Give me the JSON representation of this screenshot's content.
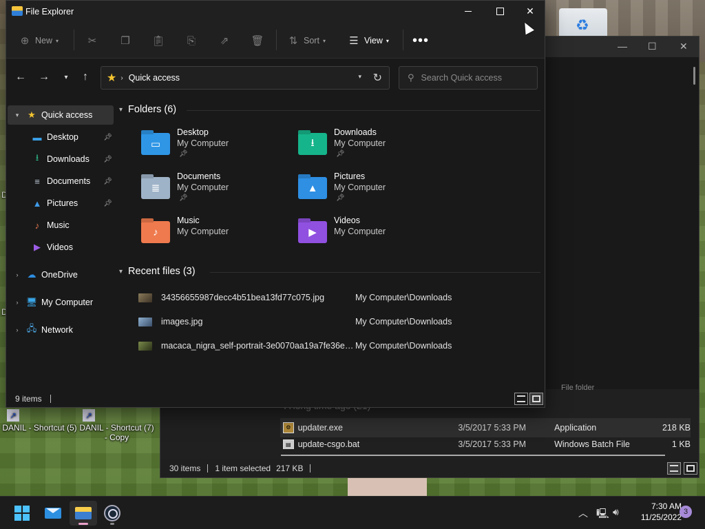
{
  "desktop": {
    "shortcut1": "DANIL - Shortcut (5)",
    "shortcut2": "DANIL - Shortcut (7) - Copy"
  },
  "background_window": {
    "group_label": "A long time ago (21)",
    "file_folder_text": "File folder",
    "rows": [
      {
        "name": "updater.exe",
        "date": "3/5/2017 5:33 PM",
        "type": "Application",
        "size": "218 KB"
      },
      {
        "name": "update-csgo.bat",
        "date": "3/5/2017 5:33 PM",
        "type": "Windows Batch File",
        "size": "1 KB"
      }
    ],
    "status": {
      "items": "30 items",
      "selected": "1 item selected",
      "size": "217 KB"
    }
  },
  "window": {
    "title": "File Explorer",
    "toolbar": {
      "new_label": "New",
      "sort_label": "Sort",
      "view_label": "View"
    },
    "address": {
      "crumb": "Quick access"
    },
    "search": {
      "placeholder": "Search Quick access"
    },
    "nav": {
      "quick_access": "Quick access",
      "pinned": [
        {
          "label": "Desktop",
          "icon": "desktop-icon",
          "color": "#3aa0e8",
          "glyph": "▬",
          "pinned": true
        },
        {
          "label": "Downloads",
          "icon": "downloads-icon",
          "color": "#2fbf8f",
          "glyph": "⭳",
          "pinned": true
        },
        {
          "label": "Documents",
          "icon": "documents-icon",
          "color": "#b8c4d0",
          "glyph": "≡",
          "pinned": true
        },
        {
          "label": "Pictures",
          "icon": "pictures-icon",
          "color": "#3f9be8",
          "glyph": "▲",
          "pinned": true
        },
        {
          "label": "Music",
          "icon": "music-icon",
          "color": "#ee7b52",
          "glyph": "♪",
          "pinned": false
        },
        {
          "label": "Videos",
          "icon": "videos-icon",
          "color": "#9b5de5",
          "glyph": "▶",
          "pinned": false
        }
      ],
      "onedrive": "OneDrive",
      "my_computer": "My Computer",
      "network": "Network"
    },
    "folders_header": "Folders (6)",
    "folders": [
      {
        "name": "Desktop",
        "location": "My Computer",
        "pinned": true,
        "color": "#2f96e6",
        "icon": "desktop-folder-icon",
        "glyph": "▭"
      },
      {
        "name": "Downloads",
        "location": "My Computer",
        "pinned": true,
        "color": "#16b48a",
        "icon": "downloads-folder-icon",
        "glyph": "⭳"
      },
      {
        "name": "Documents",
        "location": "My Computer",
        "pinned": true,
        "color": "#9fb3c8",
        "icon": "documents-folder-icon",
        "glyph": "≣"
      },
      {
        "name": "Pictures",
        "location": "My Computer",
        "pinned": true,
        "color": "#2e8fe3",
        "icon": "pictures-folder-icon",
        "glyph": "▲"
      },
      {
        "name": "Music",
        "location": "My Computer",
        "pinned": false,
        "color": "#ef7a4d",
        "icon": "music-folder-icon",
        "glyph": "♪"
      },
      {
        "name": "Videos",
        "location": "My Computer",
        "pinned": false,
        "color": "#9050e0",
        "icon": "videos-folder-icon",
        "glyph": "▶"
      }
    ],
    "recent_header": "Recent files (3)",
    "recent": [
      {
        "name": "34356655987decc4b51bea13fd77c075.jpg",
        "location": "My Computer\\Downloads",
        "thumb": "#6a5a3a"
      },
      {
        "name": "images.jpg",
        "location": "My Computer\\Downloads",
        "thumb": "#5b7fa8"
      },
      {
        "name": "macaca_nigra_self-portrait-3e0070aa19a7fe36e80...",
        "location": "My Computer\\Downloads",
        "thumb": "#4a5a2a"
      }
    ],
    "status": {
      "items": "9 items"
    }
  },
  "taskbar": {
    "time": "7:30 AM",
    "date": "11/25/2022",
    "notification_count": "3"
  }
}
